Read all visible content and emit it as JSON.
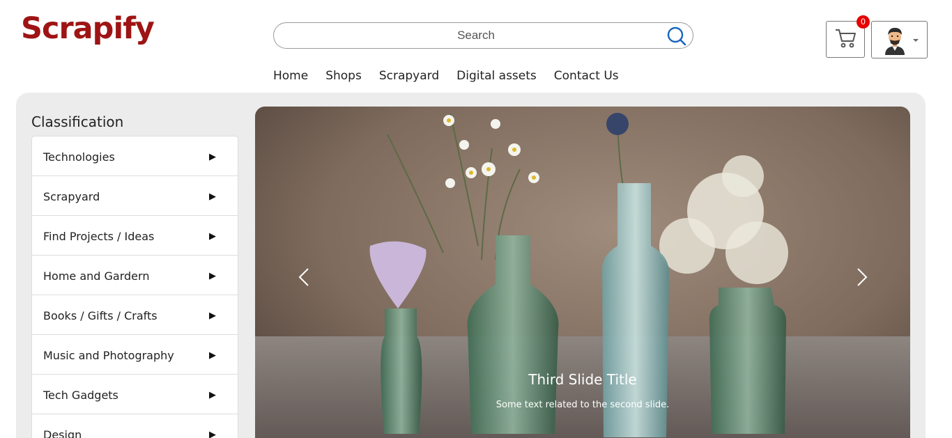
{
  "header": {
    "logo": "Scrapify",
    "search": {
      "placeholder": "Search",
      "value": ""
    },
    "cart": {
      "count": "0"
    }
  },
  "nav": {
    "items": [
      {
        "label": "Home"
      },
      {
        "label": "Shops"
      },
      {
        "label": "Scrapyard"
      },
      {
        "label": "Digital assets"
      },
      {
        "label": "Contact Us"
      }
    ]
  },
  "sidebar": {
    "title": "Classification",
    "items": [
      {
        "label": "Technologies"
      },
      {
        "label": "Scrapyard"
      },
      {
        "label": "Find Projects / Ideas"
      },
      {
        "label": "Home and Gardern"
      },
      {
        "label": "Books / Gifts / Crafts"
      },
      {
        "label": "Music and Photography"
      },
      {
        "label": "Tech Gadgets"
      },
      {
        "label": "Design"
      }
    ],
    "arrow": "▶"
  },
  "carousel": {
    "title": "Third Slide Title",
    "text": "Some text related to the second slide."
  },
  "colors": {
    "brand": "#9e1414",
    "badge": "#e60000",
    "panel": "#ececec",
    "search_icon": "#1565c0"
  }
}
